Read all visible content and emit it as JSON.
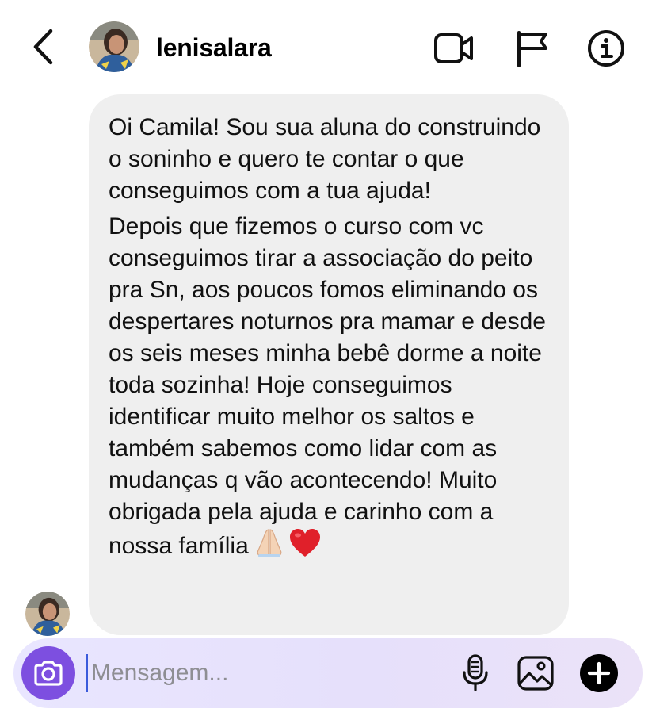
{
  "header": {
    "username": "lenisalara",
    "icons": {
      "back": "chevron-left-icon",
      "video": "video-camera-icon",
      "flag": "flag-icon",
      "info": "info-icon"
    }
  },
  "conversation": {
    "messages": [
      {
        "sender": "lenisalara",
        "paragraphs": [
          "Oi Camila! Sou sua aluna do construindo o soninho e quero te contar o que conseguimos com a tua ajuda!",
          "Depois que fizemos o curso com vc conseguimos tirar a associação do peito pra Sn, aos poucos fomos eliminando os despertares noturnos pra mamar e desde os seis meses minha bebê dorme a noite toda sozinha! Hoje conseguimos identificar muito melhor os saltos e também sabemos como lidar com as mudanças q vão acontecendo! Muito obrigada pela ajuda e carinho com a nossa família"
        ],
        "emojis": [
          "folded-hands",
          "red-heart"
        ]
      }
    ]
  },
  "composer": {
    "placeholder": "Mensagem...",
    "value": "",
    "icons": {
      "camera": "camera-icon",
      "mic": "microphone-icon",
      "gallery": "image-icon",
      "plus": "plus-circle-icon"
    },
    "accent_color": "#7d4fe0"
  },
  "colors": {
    "bubble_background": "#efefef",
    "divider": "#dcdcdc",
    "cursor": "#3b5bdb"
  }
}
